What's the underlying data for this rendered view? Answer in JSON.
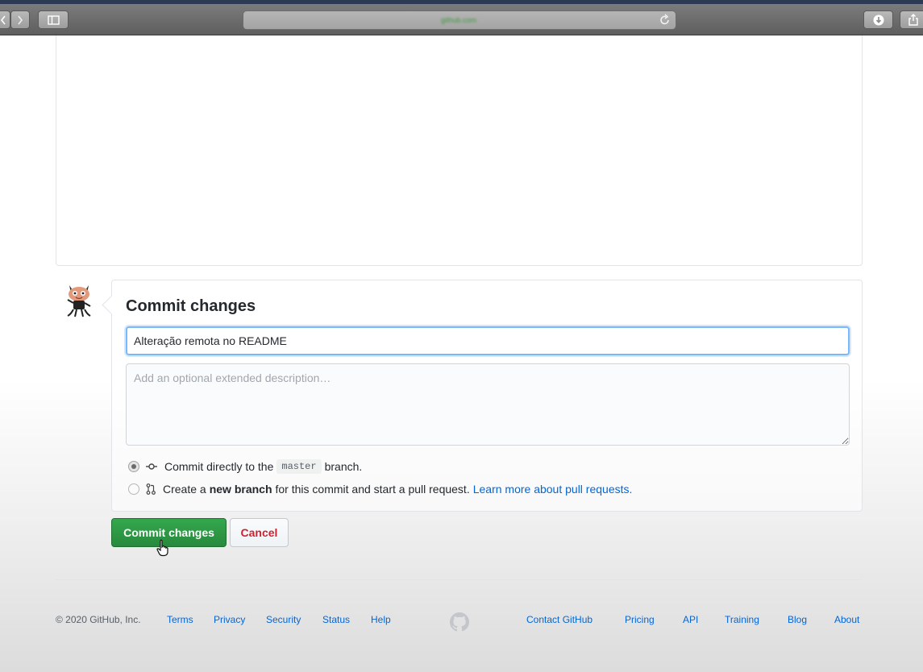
{
  "browser": {
    "url_text": "github.com",
    "icons": {
      "back": "chevron-left-icon",
      "forward": "chevron-right-icon",
      "sidebar": "sidebar-icon",
      "reload": "reload-icon",
      "download": "download-icon",
      "share": "share-icon"
    }
  },
  "commit_form": {
    "title": "Commit changes",
    "summary_value": "Alteração remota no README",
    "description_placeholder": "Add an optional extended description…",
    "option_direct": {
      "before": "Commit directly to the",
      "branch": "master",
      "after": "branch.",
      "selected": true
    },
    "option_new_branch": {
      "before": "Create a",
      "bold": "new branch",
      "after": "for this commit and start a pull request.",
      "link": "Learn more about pull requests.",
      "selected": false
    },
    "commit_button": "Commit changes",
    "cancel_button": "Cancel"
  },
  "footer": {
    "copyright": "© 2020 GitHub, Inc.",
    "left_links": [
      "Terms",
      "Privacy",
      "Security",
      "Status",
      "Help"
    ],
    "right_links": [
      "Contact GitHub",
      "Pricing",
      "API",
      "Training",
      "Blog",
      "About"
    ]
  },
  "colors": {
    "primary_green": "#2ea44f",
    "link_blue": "#0366d6",
    "danger_red": "#cb2431"
  }
}
